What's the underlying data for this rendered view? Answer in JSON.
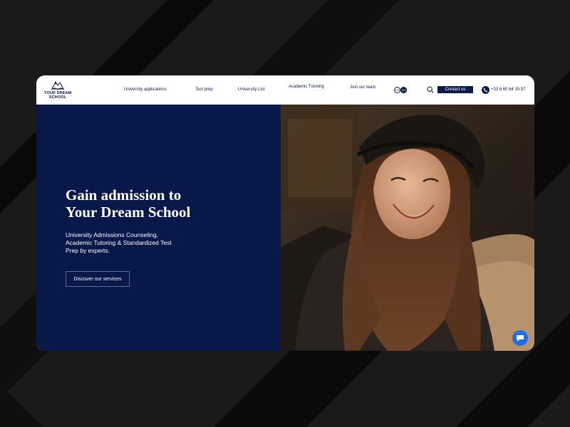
{
  "brand": {
    "name_line1": "YOUR DREAM",
    "name_line2": "SCHOOL"
  },
  "nav": {
    "items": [
      {
        "label": "University applications"
      },
      {
        "label": "Test prep"
      },
      {
        "label": "University List"
      },
      {
        "label": "Academic Tutoring"
      },
      {
        "label": "Join our team"
      }
    ],
    "languages": [
      "FR",
      "EN"
    ],
    "active_language": "EN",
    "contact_label": "Contact us",
    "phone": "+33 6 60 64 19 57"
  },
  "hero": {
    "title_line1": "Gain admission to",
    "title_line2": "Your Dream School",
    "subtitle": "University Admissions Counseling, Academic Tutoring & Standardized Test Prep by experts.",
    "cta_label": "Discover our services"
  },
  "colors": {
    "navy": "#081848",
    "brand_dark": "#0c1a4a",
    "chat_blue": "#1e6fe8",
    "page_bg": "#1b1b1b"
  },
  "icons": {
    "search": "search-icon",
    "phone": "phone-icon",
    "chat": "chat-icon",
    "logo": "open-book-mountain-icon"
  }
}
